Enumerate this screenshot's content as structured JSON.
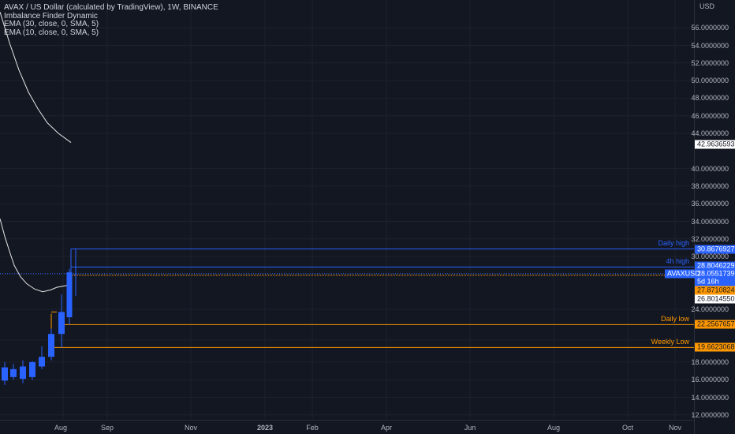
{
  "legend": {
    "title": "AVAX / US Dollar (calculated by TradingView), 1W, BINANCE",
    "indicator1": "Imbalance Finder Dynamic",
    "indicator2": "EMA (30, close, 0, SMA, 5)",
    "indicator3": "EMA (10, close, 0, SMA, 5)"
  },
  "axis": {
    "currency": "USD",
    "ticks": [
      "56.0000000",
      "54.0000000",
      "52.0000000",
      "50.0000000",
      "48.0000000",
      "46.0000000",
      "44.0000000",
      "40.0000000",
      "38.0000000",
      "36.0000000",
      "34.0000000",
      "32.0000000",
      "30.0000000",
      "24.0000000",
      "18.0000000",
      "16.0000000",
      "14.0000000",
      "12.0000000"
    ],
    "tick_values": [
      56,
      54,
      52,
      50,
      48,
      46,
      44,
      40,
      38,
      36,
      34,
      32,
      30,
      24,
      18,
      16,
      14,
      12
    ]
  },
  "tags": {
    "ema30": {
      "label": "42.9636593",
      "value": 42.9636593,
      "bg": "#ffffff",
      "fg": "#131722"
    },
    "daily_high": {
      "label": "30.8676927",
      "value": 30.8676927,
      "bg": "#2962ff",
      "fg": "#ffffff"
    },
    "h4_high": {
      "label": "28.8046229",
      "value": 28.8046229,
      "bg": "#2962ff",
      "fg": "#ffffff"
    },
    "symbol": {
      "label": "AVAXUSD",
      "value": 27.75,
      "bg": "#2962ff",
      "fg": "#ffffff"
    },
    "last_price": {
      "label": "28.0551739",
      "value": 28.0551739,
      "bg": "#2962ff",
      "fg": "#ffffff"
    },
    "countdown": {
      "label": "5d 16h",
      "value": 27.1,
      "bg": "#2962ff",
      "fg": "#ffffff"
    },
    "orange_level": {
      "label": "27.8710824",
      "value": 25.6,
      "bg": "#ff9800",
      "fg": "#131722"
    },
    "ema10": {
      "label": "26.8014550",
      "value": 24.65,
      "bg": "#ffffff",
      "fg": "#131722"
    },
    "daily_low": {
      "label": "22.2567657",
      "value": 22.2567657,
      "bg": "#ff9800",
      "fg": "#131722"
    },
    "weekly_low": {
      "label": "19.6623068",
      "value": 19.6623068,
      "bg": "#ff9800",
      "fg": "#131722"
    }
  },
  "levels": {
    "daily_high": {
      "text": "Daily high",
      "value": 30.8676927,
      "color": "#2962ff"
    },
    "h4_high": {
      "text": "4h high",
      "value": 28.8046229,
      "color": "#2962ff"
    },
    "daily_low": {
      "text": "Daily low",
      "value": 22.2567657,
      "color": "#ff9800"
    },
    "weekly_low": {
      "text": "Weekly Low",
      "value": 19.6623068,
      "color": "#ff9800"
    }
  },
  "time_axis": {
    "labels": [
      "Aug",
      "Sep",
      "Nov",
      "2023",
      "Feb",
      "Apr",
      "Jun",
      "Aug",
      "Oct",
      "Nov"
    ]
  },
  "chart_data": {
    "type": "candlestick",
    "up_color": "#2962ff",
    "down_color": "#ffffff",
    "candles": [
      {
        "open": 15.9,
        "high": 18.0,
        "low": 15.4,
        "close": 17.4
      },
      {
        "open": 16.3,
        "high": 17.8,
        "low": 16.0,
        "close": 17.2
      },
      {
        "open": 16.1,
        "high": 18.2,
        "low": 15.6,
        "close": 17.5
      },
      {
        "open": 16.3,
        "high": 18.1,
        "low": 16.0,
        "close": 18.0
      },
      {
        "open": 17.5,
        "high": 19.8,
        "low": 17.2,
        "close": 18.6
      },
      {
        "open": 18.6,
        "high": 21.8,
        "low": 18.2,
        "close": 21.2
      },
      {
        "open": 21.2,
        "high": 25.7,
        "low": 19.6623068,
        "close": 23.7
      },
      {
        "open": 23.1,
        "high": 28.6,
        "low": 22.2567657,
        "close": 28.2
      },
      {
        "open": 28.0551739,
        "high": 30.8676927,
        "low": 25.5,
        "close": 28.0551739
      }
    ],
    "ema30": [
      57.8,
      54.3,
      51.2,
      48.7,
      46.8,
      45.2,
      44.0,
      42.9636593
    ],
    "ema10": [
      34.3,
      32.3,
      30.6,
      29.0,
      27.7,
      26.9,
      26.3,
      26.0,
      26.2,
      26.5,
      26.801455
    ],
    "ylim": [
      11.4,
      57.7
    ]
  }
}
